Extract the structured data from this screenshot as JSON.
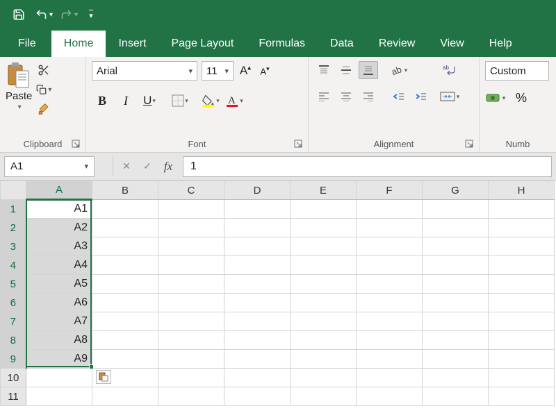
{
  "qat": {
    "save_icon": "save-icon",
    "undo_icon": "undo-icon",
    "redo_icon": "redo-icon",
    "customize_icon": "chevron-down-icon"
  },
  "tabs": {
    "file": "File",
    "home": "Home",
    "insert": "Insert",
    "page_layout": "Page Layout",
    "formulas": "Formulas",
    "data": "Data",
    "review": "Review",
    "view": "View",
    "help": "Help"
  },
  "ribbon": {
    "clipboard": {
      "label": "Clipboard",
      "paste": "Paste"
    },
    "font": {
      "label": "Font",
      "name": "Arial",
      "size": "11"
    },
    "alignment": {
      "label": "Alignment"
    },
    "number": {
      "label": "Numb",
      "format": "Custom",
      "percent": "%"
    }
  },
  "formula_bar": {
    "name_box": "A1",
    "fx": "fx",
    "formula": "1"
  },
  "grid": {
    "columns": [
      "A",
      "B",
      "C",
      "D",
      "E",
      "F",
      "G",
      "H"
    ],
    "row_count": 11,
    "selected_column": "A",
    "selected_rows_start": 1,
    "selected_rows_end": 9,
    "active_cell_row": 1,
    "cells_A": [
      "A1",
      "A2",
      "A3",
      "A4",
      "A5",
      "A6",
      "A7",
      "A8",
      "A9",
      "",
      ""
    ]
  }
}
